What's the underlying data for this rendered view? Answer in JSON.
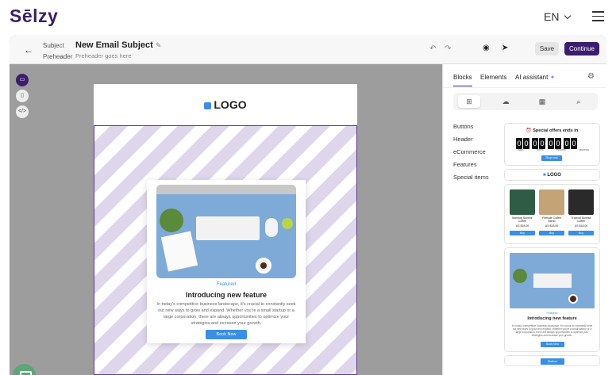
{
  "brand": "Sēlzy",
  "language": "EN",
  "toolbar": {
    "subject_label": "Subject",
    "subject_value": "New Email Subject",
    "preheader_label": "Preheader",
    "preheader_placeholder": "Preheader goes here",
    "save_label": "Save",
    "continue_label": "Continue"
  },
  "email": {
    "logo_text": "LOGO",
    "card": {
      "tag": "Featured",
      "title": "Introducing new feature",
      "body": "In today's competitive business landscape, it's crucial to constantly seek out new ways to grow and expand. Whether you're a small startup or a large corporation, there are always opportunities to optimize your strategies and increase your growth.",
      "button": "Book Now"
    }
  },
  "panel": {
    "tabs": [
      "Blocks",
      "Elements",
      "AI assistant"
    ],
    "active_tab": "Blocks",
    "categories": [
      "Buttons",
      "Header",
      "eCommerce",
      "Features",
      "Special items"
    ],
    "thumb_timer": {
      "title": "Special offers ends in",
      "digits": [
        "0",
        "0",
        "0",
        "0",
        "0",
        "0",
        "0",
        "0"
      ],
      "units": [
        "days",
        "hours",
        "minutes",
        "seconds"
      ],
      "button": "Shop now"
    },
    "thumb_logo": "LOGO",
    "thumb_products": [
      {
        "name": "Morning Sunrise Coffee",
        "price": "US $18.00",
        "button": "Buy"
      },
      {
        "name": "Fireside Coffee Blend",
        "price": "US $18.00",
        "button": "Buy"
      },
      {
        "name": "Tropical Sunrise Coffee",
        "price": "US $18.00",
        "button": "Buy"
      }
    ],
    "thumb_feature": {
      "tag": "Featured",
      "title": "Introducing new feature",
      "body": "In today's competitive business landscape, it's crucial to constantly seek out new ways to grow and expand. Whether you're a small startup or a large corporation, there are always opportunities to optimize your strategies and increase your growth.",
      "button": "Book Now"
    },
    "thumb_button": "Button"
  },
  "colors": {
    "brand": "#3b1d6e",
    "accent": "#3a8ee6"
  }
}
